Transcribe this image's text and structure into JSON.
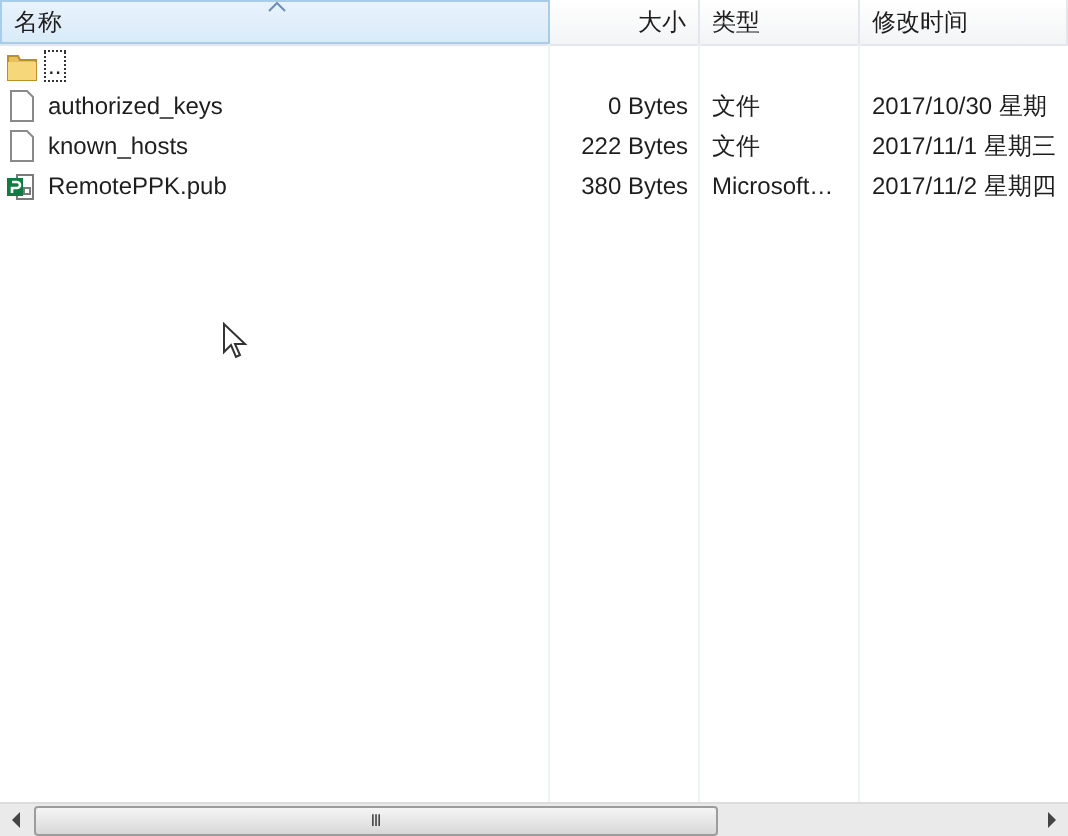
{
  "columns": [
    {
      "label": "名称",
      "selected": true
    },
    {
      "label": "大小",
      "selected": false
    },
    {
      "label": "类型",
      "selected": false
    },
    {
      "label": "修改时间",
      "selected": false
    }
  ],
  "rows": [
    {
      "kind": "folder",
      "name": "..",
      "focused": true
    },
    {
      "kind": "file",
      "name": "authorized_keys",
      "size": "0 Bytes",
      "type": "文件",
      "modified": "2017/10/30 星期",
      "focused": false
    },
    {
      "kind": "file",
      "name": "known_hosts",
      "size": "222 Bytes",
      "type": "文件",
      "modified": "2017/11/1 星期三",
      "focused": false
    },
    {
      "kind": "publisher",
      "name": "RemotePPK.pub",
      "size": "380 Bytes",
      "type": "Microsoft…",
      "modified": "2017/11/2 星期四",
      "focused": false
    }
  ],
  "scrollbar": {
    "grip": "Ⅲ"
  }
}
